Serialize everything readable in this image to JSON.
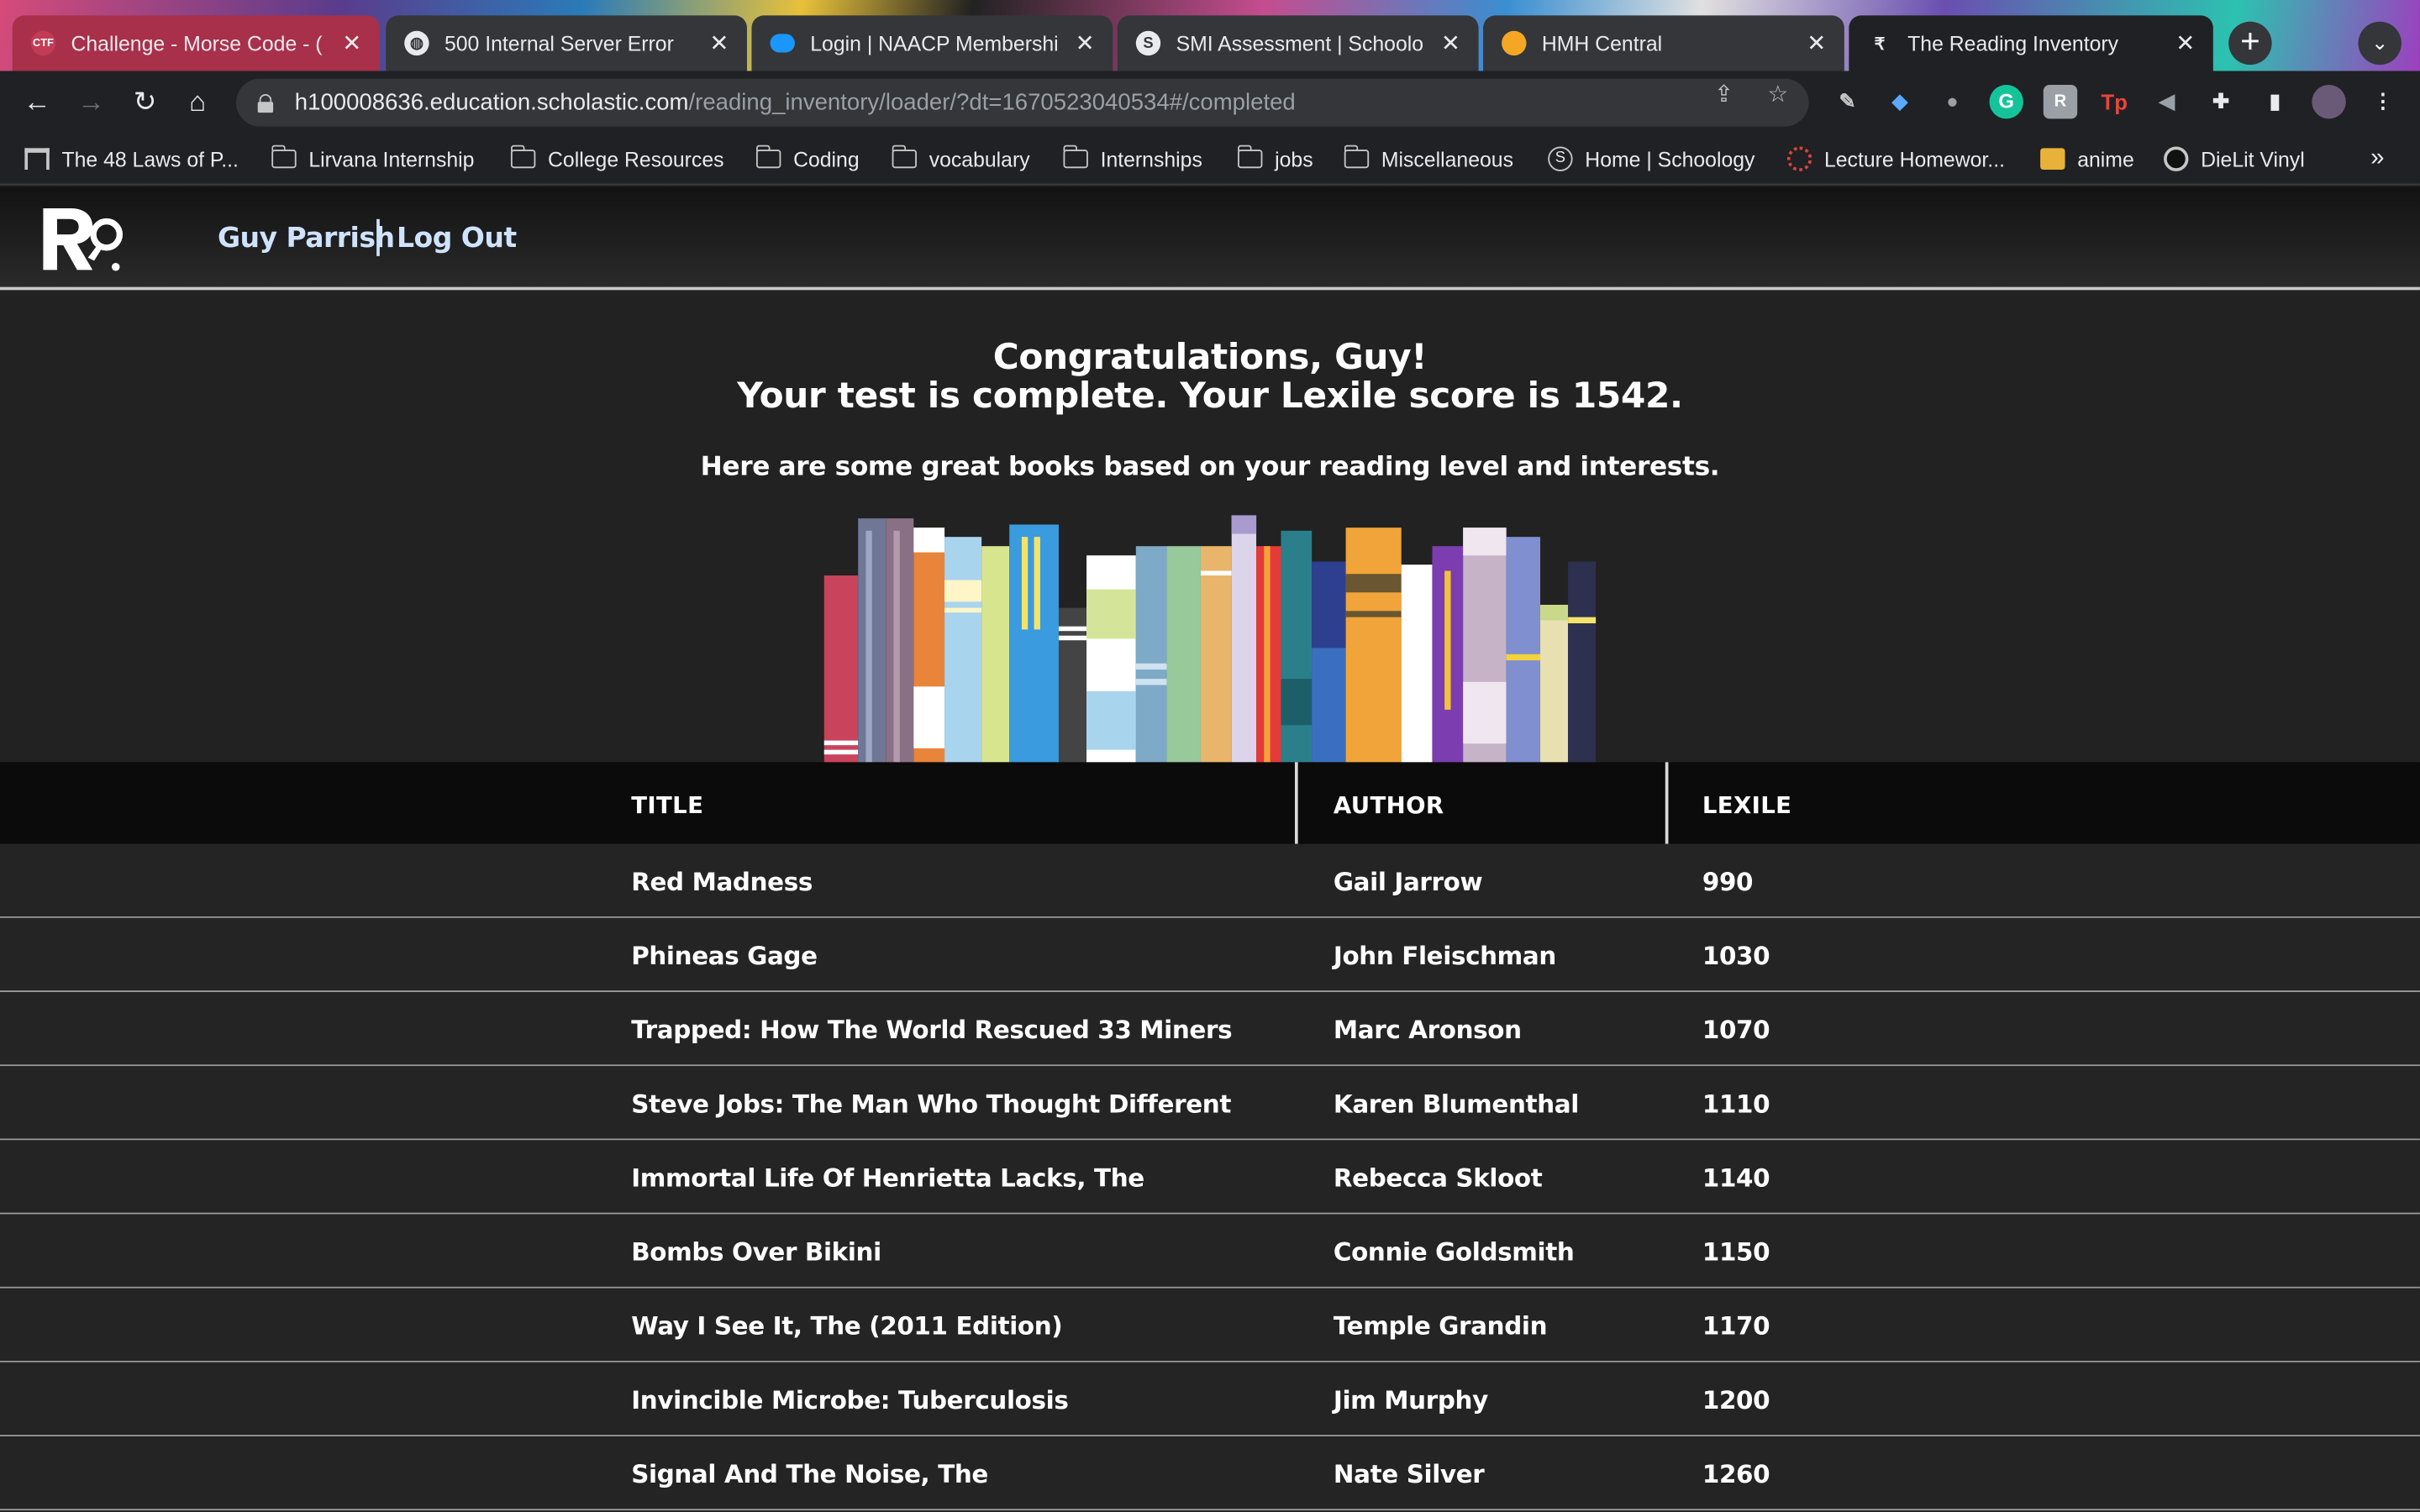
{
  "browser": {
    "tabs": [
      {
        "label": "Challenge - Morse Code - (",
        "icon": "ctf-icon"
      },
      {
        "label": "500 Internal Server Error",
        "icon": "globe-icon"
      },
      {
        "label": "Login | NAACP Membershi",
        "icon": "salesforce-cloud-icon"
      },
      {
        "label": "SMI Assessment | Schoolo",
        "icon": "schoology-icon"
      },
      {
        "label": "HMH Central",
        "icon": "hmh-dot-icon"
      },
      {
        "label": "The Reading Inventory",
        "icon": "reading-inventory-icon"
      }
    ],
    "url_host": "h100008636.education.scholastic.com",
    "url_path": "/reading_inventory/loader/?dt=1670523040534#/completed",
    "bookmarks": [
      {
        "label": "The 48 Laws of P...",
        "icon": "library-icon"
      },
      {
        "label": "Lirvana Internship",
        "icon": "folder-icon"
      },
      {
        "label": "College Resources",
        "icon": "folder-icon"
      },
      {
        "label": "Coding",
        "icon": "folder-icon"
      },
      {
        "label": "vocabulary",
        "icon": "folder-icon"
      },
      {
        "label": "Internships",
        "icon": "folder-icon"
      },
      {
        "label": "jobs",
        "icon": "folder-icon"
      },
      {
        "label": "Miscellaneous",
        "icon": "folder-icon"
      },
      {
        "label": "Home | Schoology",
        "icon": "schoology-icon"
      },
      {
        "label": "Lecture Homewor...",
        "icon": "circle-icon"
      },
      {
        "label": "anime",
        "icon": "image-icon"
      },
      {
        "label": "DieLit Vinyl",
        "icon": "vinyl-icon"
      }
    ],
    "bookmarks_more": "»"
  },
  "app": {
    "user_name": "Guy Parrish",
    "logout_label": "Log Out",
    "congrats_line1": "Congratulations, Guy!",
    "congrats_line2": "Your test is complete. Your Lexile score is 1542.",
    "subtitle": "Here are some great books based on your reading level and interests."
  },
  "table": {
    "headers": {
      "title": "TITLE",
      "author": "AUTHOR",
      "lexile": "LEXILE"
    },
    "rows": [
      {
        "title": "Red Madness",
        "author": "Gail Jarrow",
        "lexile": "990"
      },
      {
        "title": "Phineas Gage",
        "author": "John Fleischman",
        "lexile": "1030"
      },
      {
        "title": "Trapped: How The World Rescued 33 Miners",
        "author": "Marc Aronson",
        "lexile": "1070"
      },
      {
        "title": "Steve Jobs: The Man Who Thought Different",
        "author": "Karen Blumenthal",
        "lexile": "1110"
      },
      {
        "title": "Immortal Life Of Henrietta Lacks, The",
        "author": "Rebecca Skloot",
        "lexile": "1140"
      },
      {
        "title": "Bombs Over Bikini",
        "author": "Connie Goldsmith",
        "lexile": "1150"
      },
      {
        "title": "Way I See It, The (2011 Edition)",
        "author": "Temple Grandin",
        "lexile": "1170"
      },
      {
        "title": "Invincible Microbe: Tuberculosis",
        "author": "Jim Murphy",
        "lexile": "1200"
      },
      {
        "title": "Signal And The Noise, The",
        "author": "Nate Silver",
        "lexile": "1260"
      }
    ]
  },
  "colors": {
    "page_bg": "#222222",
    "header_link": "#cfe3ff",
    "table_head_bg": "#0b0b0b"
  }
}
